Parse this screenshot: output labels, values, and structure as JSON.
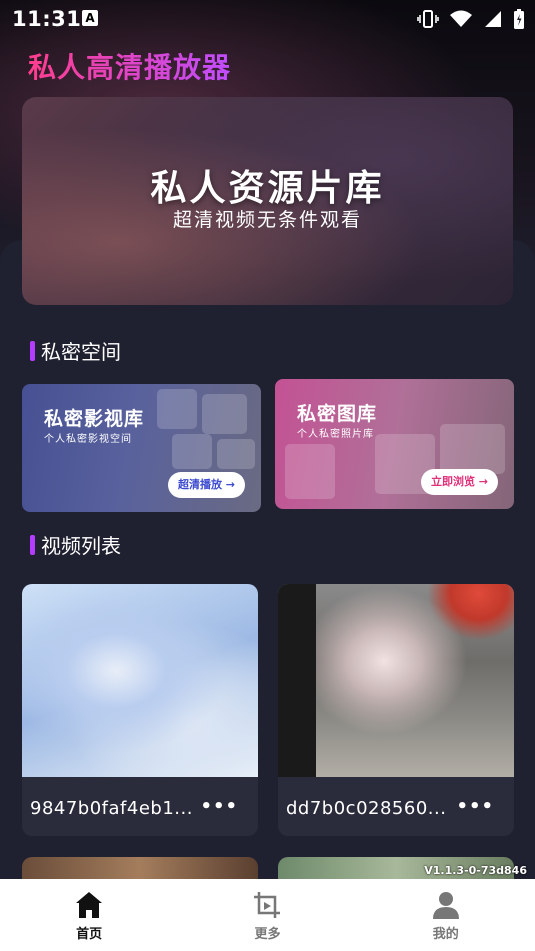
{
  "status_bar": {
    "time": "11:31",
    "notification_badge": "A"
  },
  "app": {
    "title": "私人高清播放器"
  },
  "hero": {
    "title": "私人资源片库",
    "subtitle": "超清视频无条件观看"
  },
  "sections": {
    "private_space": "私密空间",
    "video_list": "视频列表"
  },
  "cards": [
    {
      "title": "私密影视库",
      "subtitle": "个人私密影视空间",
      "button": "超清播放 →"
    },
    {
      "title": "私密图库",
      "subtitle": "个人私密照片库",
      "button": "立即浏览 →"
    }
  ],
  "videos": [
    {
      "name": "9847b0faf4eb1...",
      "more": "•••"
    },
    {
      "name": "dd7b0c028560...",
      "more": "•••"
    }
  ],
  "version": "V1.1.3-0-73d846",
  "tabs": [
    {
      "label": "首页",
      "icon": "home-icon",
      "active": true
    },
    {
      "label": "更多",
      "icon": "crop-icon",
      "active": false
    },
    {
      "label": "我的",
      "icon": "person-icon",
      "active": false
    }
  ],
  "colors": {
    "accent": "#b43cff",
    "title_gradient": [
      "#ff3d8d",
      "#c04dff"
    ],
    "background": "#1f2030"
  }
}
